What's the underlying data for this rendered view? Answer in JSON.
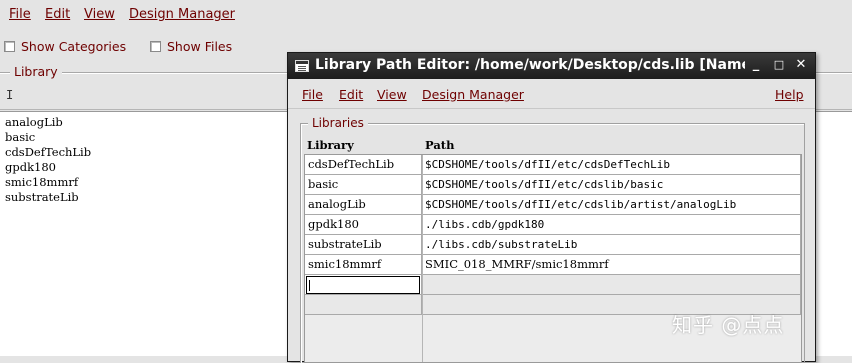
{
  "main_window": {
    "menu": [
      {
        "label": "File"
      },
      {
        "label": "Edit"
      },
      {
        "label": "View"
      },
      {
        "label": "Design Manager"
      }
    ],
    "show_categories": {
      "label": "Show Categories",
      "checked": false
    },
    "show_files": {
      "label": "Show Files",
      "checked": false
    },
    "library_group_label": "Library",
    "libraries": [
      "analogLib",
      "basic",
      "cdsDefTechLib",
      "gpdk180",
      "smic18mmrf",
      "substrateLib"
    ]
  },
  "dialog": {
    "title": "Library Path Editor: /home/work/Desktop/cds.lib [NameS",
    "title_buttons": {
      "minimize": "_",
      "maximize": "□",
      "close": "✕"
    },
    "menu": [
      {
        "label": "File"
      },
      {
        "label": "Edit"
      },
      {
        "label": "View"
      },
      {
        "label": "Design Manager"
      }
    ],
    "help_label": "Help",
    "group_label": "Libraries",
    "columns": {
      "library": "Library",
      "path": "Path"
    },
    "rows": [
      {
        "library": "cdsDefTechLib",
        "path": "$CDSHOME/tools/dfII/etc/cdsDefTechLib"
      },
      {
        "library": "basic",
        "path": "$CDSHOME/tools/dfII/etc/cdslib/basic"
      },
      {
        "library": "analogLib",
        "path": "$CDSHOME/tools/dfII/etc/cdslib/artist/analogLib"
      },
      {
        "library": "gpdk180",
        "path": "./libs.cdb/gpdk180"
      },
      {
        "library": "substrateLib",
        "path": "./libs.cdb/substrateLib"
      },
      {
        "library": "smic18mmrf",
        "path": "SMIC_018_MMRF/smic18mmrf"
      }
    ]
  },
  "watermark": "知乎 @点点"
}
